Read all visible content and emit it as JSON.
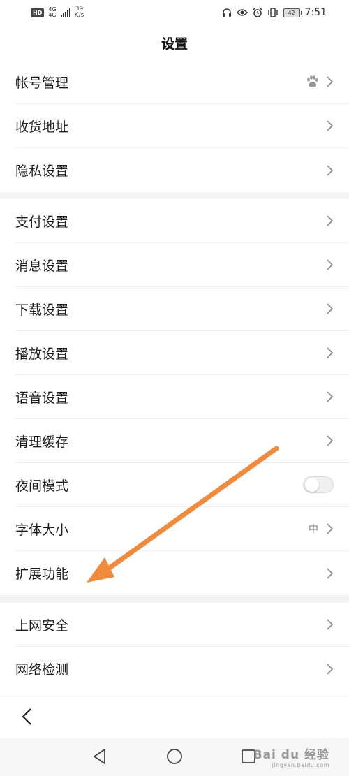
{
  "status_bar": {
    "hd": "HD",
    "network_top": "4G",
    "network_bottom": "4G",
    "speed_value": "39",
    "speed_unit": "K/s",
    "battery": "42",
    "time": "7:51"
  },
  "header": {
    "title": "设置"
  },
  "sections": [
    {
      "items": [
        {
          "label": "帐号管理",
          "trailing": "baidu-paw-icon"
        },
        {
          "label": "收货地址"
        },
        {
          "label": "隐私设置"
        }
      ]
    },
    {
      "items": [
        {
          "label": "支付设置"
        },
        {
          "label": "消息设置"
        },
        {
          "label": "下载设置"
        },
        {
          "label": "播放设置"
        },
        {
          "label": "语音设置"
        },
        {
          "label": "清理缓存"
        },
        {
          "label": "夜间模式",
          "toggle_on": false
        },
        {
          "label": "字体大小",
          "value": "中"
        },
        {
          "label": "扩展功能"
        }
      ]
    },
    {
      "items": [
        {
          "label": "上网安全"
        },
        {
          "label": "网络检测"
        }
      ]
    }
  ],
  "watermark": {
    "main": "Bai du 经验",
    "sub": "jingyan.baidu.com"
  },
  "colors": {
    "annotation_arrow": "#f08a3c",
    "section_gap": "#f3f3f3",
    "divider": "#eeeeee"
  }
}
